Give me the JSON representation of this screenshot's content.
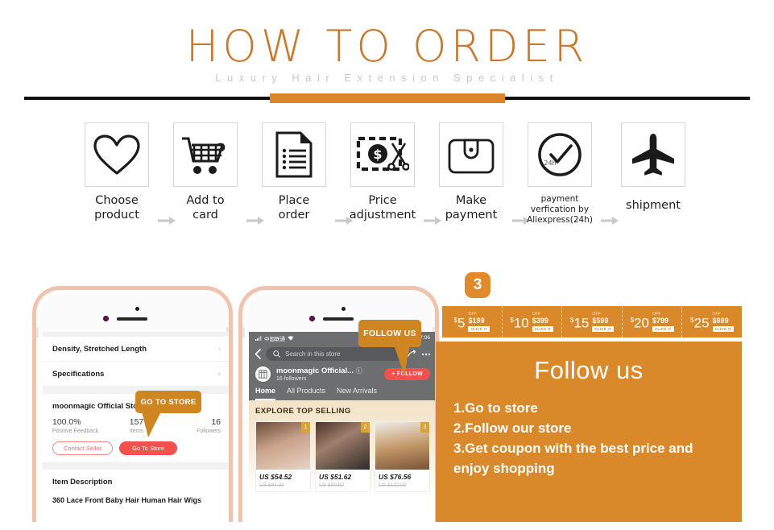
{
  "header": {
    "title": "HOW TO ORDER",
    "subtitle": "Luxury Hair Extension Specialist",
    "accent_color": "#d9862a",
    "title_color": "#c8792f"
  },
  "steps": [
    {
      "icon": "heart-icon",
      "label_line1": "Choose",
      "label_line2": "product"
    },
    {
      "icon": "shopping-cart-icon",
      "label_line1": "Add to",
      "label_line2": "card"
    },
    {
      "icon": "document-list-icon",
      "label_line1": "Place",
      "label_line2": "order"
    },
    {
      "icon": "price-scissors-icon",
      "label_line1": "Price",
      "label_line2": "adjustment"
    },
    {
      "icon": "wallet-icon",
      "label_line1": "Make",
      "label_line2": "payment"
    },
    {
      "icon": "clock-check-24h-icon",
      "label_line1": "payment",
      "label_line2": "verfication by",
      "label_line3": "Aliexpress(24h)",
      "icon_text": "24h"
    },
    {
      "icon": "airplane-icon",
      "label_line1": "shipment",
      "label_line2": ""
    }
  ],
  "left_phone": {
    "tooltip": "GO TO STORE",
    "rows": [
      {
        "label": "Density, Stretched Length",
        "chevron": "›"
      },
      {
        "label": "Specifications",
        "chevron": "›"
      }
    ],
    "store_name": "moonmagic Official Store",
    "stats": [
      {
        "value": "100.0%",
        "label": "Positive Feedback"
      },
      {
        "value": "157",
        "label": "Items"
      },
      {
        "value": "16",
        "label": "Followers"
      }
    ],
    "contact_button": "Contact Seller",
    "store_button": "Go To Store",
    "description_heading": "Item Description",
    "description_text": "360 Lace Front Baby Hair Human Hair Wigs"
  },
  "right_phone": {
    "tooltip": "FOLLOW US",
    "carrier": "中国联通",
    "time": "17:06",
    "search_placeholder": "Search in this store",
    "store_name": "moonmagic Official...",
    "followers": "16  followers",
    "follow_button": "+ FOLLOW",
    "tabs": [
      "Home",
      "All Products",
      "New Arrivals"
    ],
    "active_tab": "Home",
    "section_title": "EXPLORE TOP SELLING",
    "products": [
      {
        "rank": "1",
        "price": "US $54.52",
        "old_price": "US $84.00"
      },
      {
        "rank": "2",
        "price": "US $51.62",
        "old_price": "US $89.00"
      },
      {
        "rank": "3",
        "price": "US $76.56",
        "old_price": "US $122.00"
      }
    ]
  },
  "right_panel": {
    "step_number": "3",
    "accent_color": "#d9892a",
    "coupons": [
      {
        "amount": "5",
        "currency": "$",
        "off_label": "OFF",
        "threshold": "$199",
        "cta": "CLICK IT"
      },
      {
        "amount": "10",
        "currency": "$",
        "off_label": "OFF",
        "threshold": "$399",
        "cta": "CLICK IT"
      },
      {
        "amount": "15",
        "currency": "$",
        "off_label": "OFF",
        "threshold": "$599",
        "cta": "CLICK IT"
      },
      {
        "amount": "20",
        "currency": "$",
        "off_label": "OFF",
        "threshold": "$799",
        "cta": "CLICK IT"
      },
      {
        "amount": "25",
        "currency": "$",
        "off_label": "OFF",
        "threshold": "$999",
        "cta": "CLICK IT"
      }
    ],
    "title": "Follow us",
    "instructions": [
      "1.Go to store",
      "2.Follow our store",
      "3.Get coupon with the best price and",
      " enjoy shopping"
    ]
  }
}
